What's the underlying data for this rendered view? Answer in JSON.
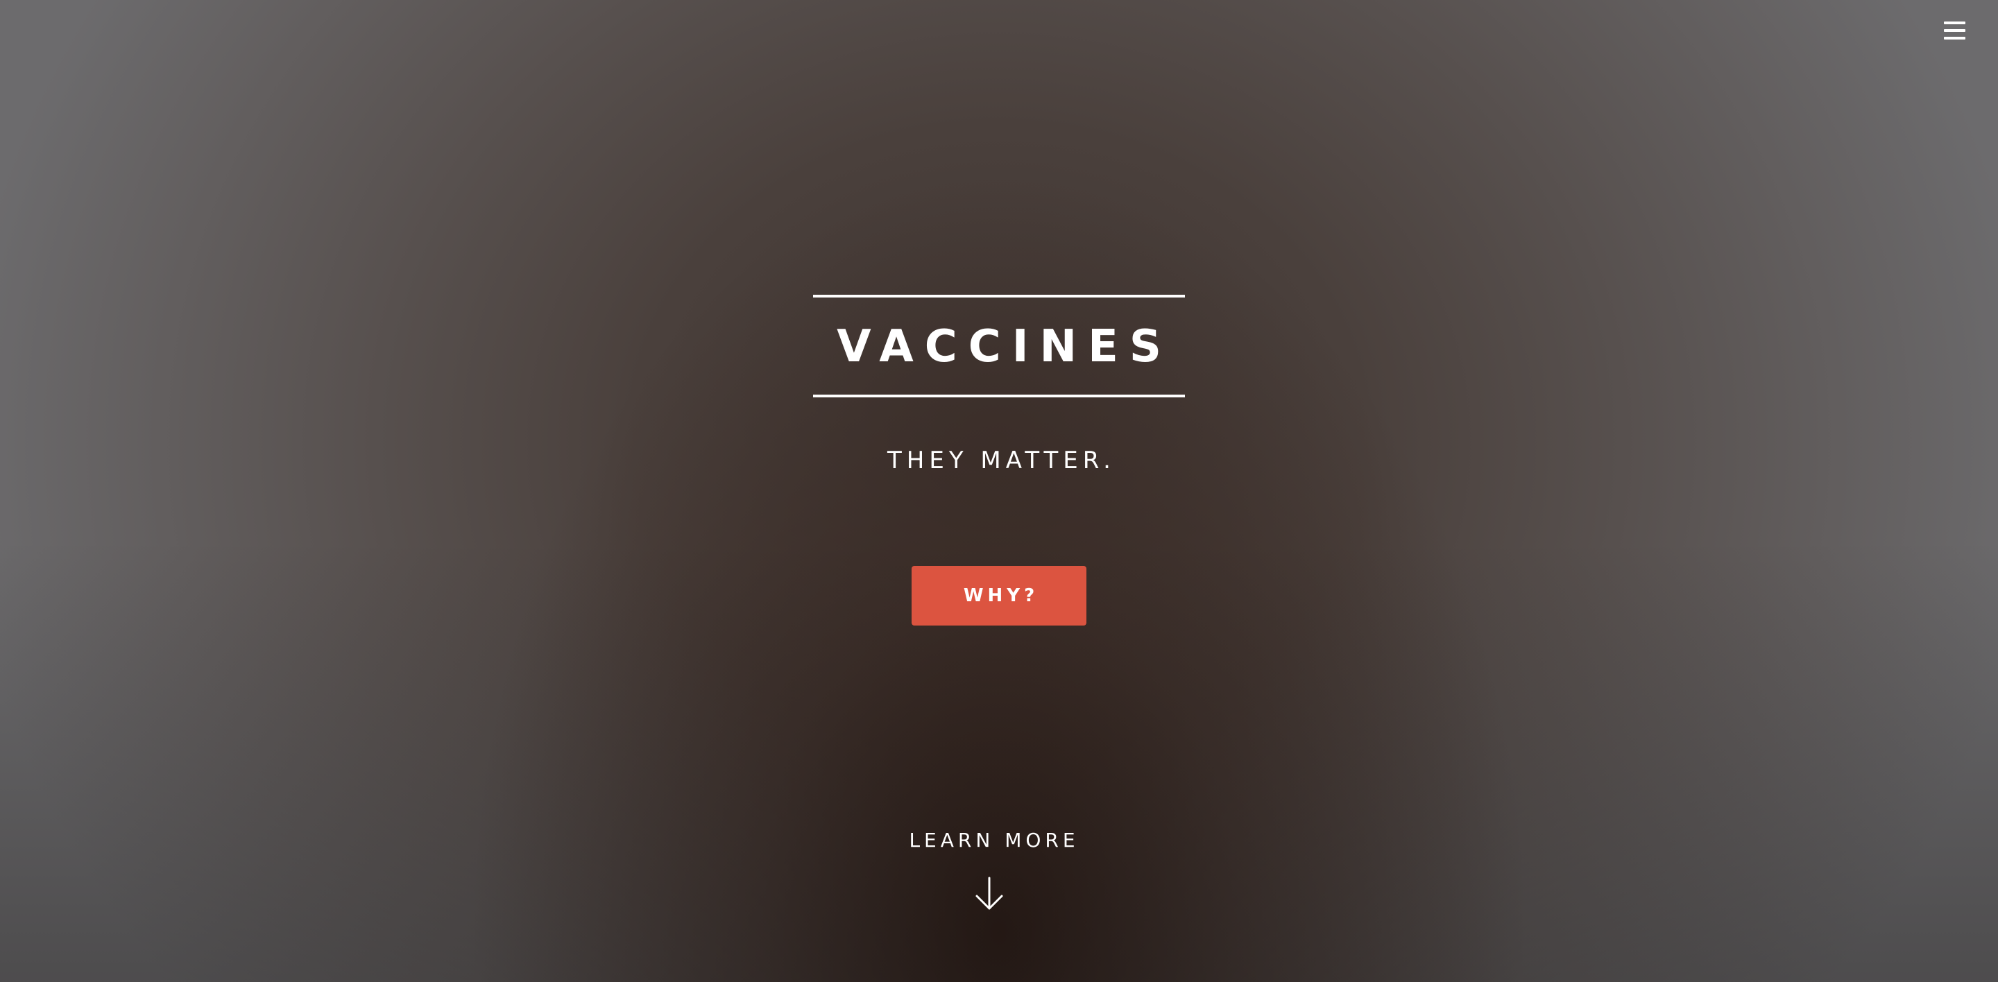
{
  "header": {
    "menu_icon": "hamburger-menu-icon"
  },
  "hero": {
    "title": "VACCINES",
    "subtitle": "THEY MATTER.",
    "cta_label": "WHY?",
    "learn_more_label": "LEARN MORE",
    "learn_more_icon": "arrow-down-icon"
  },
  "colors": {
    "accent": "#dc5440",
    "text": "#ffffff",
    "background_center": "#3f3430",
    "background_edge": "#6c6b6d"
  }
}
